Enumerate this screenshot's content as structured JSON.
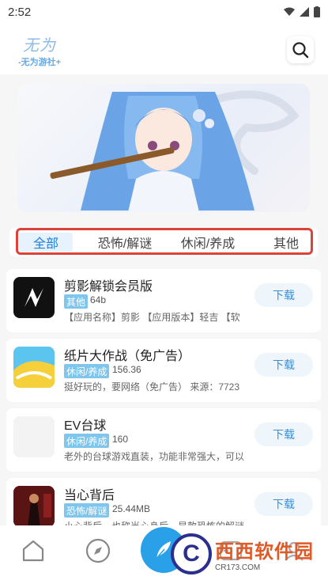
{
  "status": {
    "time": "2:52"
  },
  "header": {
    "logo_script": "无为",
    "logo_text": "-无为游社+",
    "search_icon": "search-icon"
  },
  "tabs": [
    {
      "label": "全部",
      "active": true
    },
    {
      "label": "恐怖/解谜",
      "active": false
    },
    {
      "label": "休闲/养成",
      "active": false
    },
    {
      "label": "其他",
      "active": false
    }
  ],
  "apps": [
    {
      "title": "剪影解锁会员版",
      "tag": "其他",
      "size": "64b",
      "desc": "【应用名称】剪影 【应用版本】轻吉 【软",
      "download": "下载"
    },
    {
      "title": "纸片大作战（免广告）",
      "tag": "休闲/养成",
      "size": "156.36",
      "desc": "挺好玩的，要网络（免广告） 来源：7723",
      "download": "下载"
    },
    {
      "title": "EV台球",
      "tag": "休闲/养成",
      "size": "160",
      "desc": "老外的台球游戏直装，功能非常强大，可以",
      "download": "下载"
    },
    {
      "title": "当心背后",
      "tag": "恐怖/解谜",
      "size": "25.44MB",
      "desc": "小心背后，也称当心身后，是款恐怖的解谜",
      "download": "下载"
    }
  ],
  "bottom_nav": {
    "items": [
      "home-icon",
      "compass-icon",
      "feather-icon",
      "gamepad-icon",
      "user-icon"
    ]
  },
  "watermark": {
    "big": "西西软件园",
    "small": "CR173.COM",
    "letter": "C"
  },
  "colors": {
    "accent": "#2aa0e8",
    "tag": "#7fc6ee",
    "tab_outline": "#d9433a"
  }
}
